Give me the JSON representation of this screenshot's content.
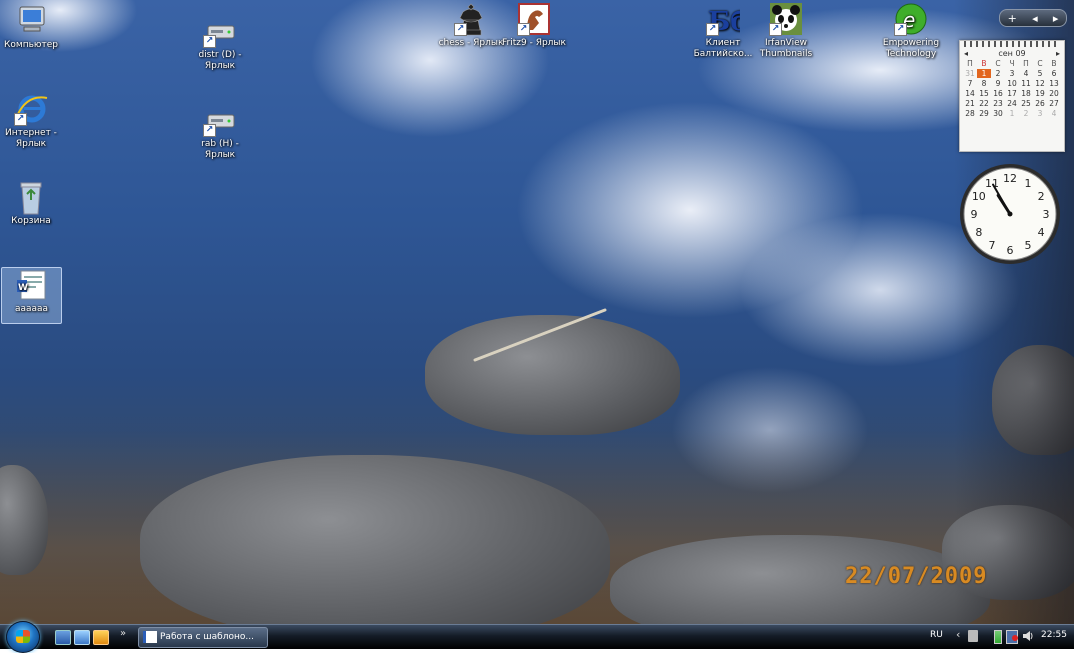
{
  "wallpaper": {
    "date_stamp": "22/07/2009"
  },
  "desktop_icons": [
    {
      "name": "computer-icon",
      "label": "Компьютер"
    },
    {
      "name": "drive-d-icon",
      "label": "distr (D) - Ярлык"
    },
    {
      "name": "chess-icon",
      "label": "chess - Ярлык"
    },
    {
      "name": "fritz-icon",
      "label": "Fritz9 - Ярлык"
    },
    {
      "name": "bank-client-icon",
      "label": "Клиент Балтийско..."
    },
    {
      "name": "irfanview-icon",
      "label": "IrfanView Thumbnails"
    },
    {
      "name": "empowering-icon",
      "label": "Empowering Technology"
    },
    {
      "name": "ie-icon",
      "label": "Интернет - Ярлык"
    },
    {
      "name": "drive-h-icon",
      "label": "rab (H) - Ярлык"
    },
    {
      "name": "recycle-bin-icon",
      "label": "Корзина"
    },
    {
      "name": "document-icon",
      "label": "aaaaaa"
    }
  ],
  "sidebar": {
    "add_glyph": "+",
    "prev_glyph": "◂",
    "next_glyph": "▸"
  },
  "calendar": {
    "month_label": "сен 09",
    "prev_glyph": "◂",
    "next_glyph": "▸",
    "weekdays": [
      "П",
      "В",
      "С",
      "Ч",
      "П",
      "С",
      "В"
    ],
    "days": [
      [
        "31",
        "1",
        "2",
        "3",
        "4",
        "5",
        "6"
      ],
      [
        "7",
        "8",
        "9",
        "10",
        "11",
        "12",
        "13"
      ],
      [
        "14",
        "15",
        "16",
        "17",
        "18",
        "19",
        "20"
      ],
      [
        "21",
        "22",
        "23",
        "24",
        "25",
        "26",
        "27"
      ],
      [
        "28",
        "29",
        "30",
        "1",
        "2",
        "3",
        "4"
      ]
    ],
    "today": "1"
  },
  "clock": {
    "numerals": [
      "12",
      "1",
      "2",
      "3",
      "4",
      "5",
      "6",
      "7",
      "8",
      "9",
      "10",
      "11"
    ],
    "hour": 10,
    "minute": 55
  },
  "taskbar": {
    "quicklaunch_chevron": "»",
    "task_button_label": "Работа с шаблоно...",
    "language": "RU",
    "tray_chevron": "‹",
    "time": "22:55"
  }
}
